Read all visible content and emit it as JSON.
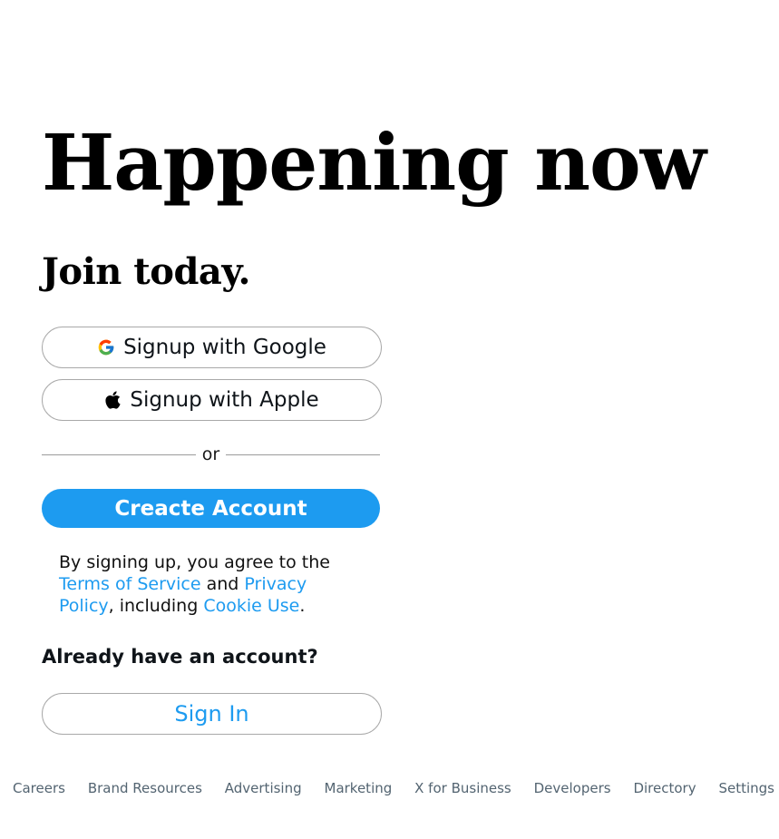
{
  "hero": {
    "title": "Happening now",
    "subtitle": "Join today."
  },
  "auth": {
    "google_label": "Signup with Google",
    "google_icon": "google-g-icon",
    "apple_label": "Signup with Apple",
    "apple_icon": "apple-icon",
    "divider_text": "or",
    "create_label": "Creacte Account",
    "terms": {
      "prefix": "By signing up, you agree to the ",
      "tos_link": "Terms of Service",
      "and": " and ",
      "privacy_link": "Privacy Policy",
      "including": ", including ",
      "cookie_link": "Cookie Use",
      "suffix": "."
    },
    "already_text": "Already have an account?",
    "signin_label": "Sign In"
  },
  "footer": {
    "links": [
      "Careers",
      "Brand Resources",
      "Advertising",
      "Marketing",
      "X for Business",
      "Developers",
      "Directory",
      "Settings"
    ]
  },
  "colors": {
    "accent": "#1d9bf0",
    "button_border": "#a9a9a9",
    "footer_text": "#536471"
  }
}
